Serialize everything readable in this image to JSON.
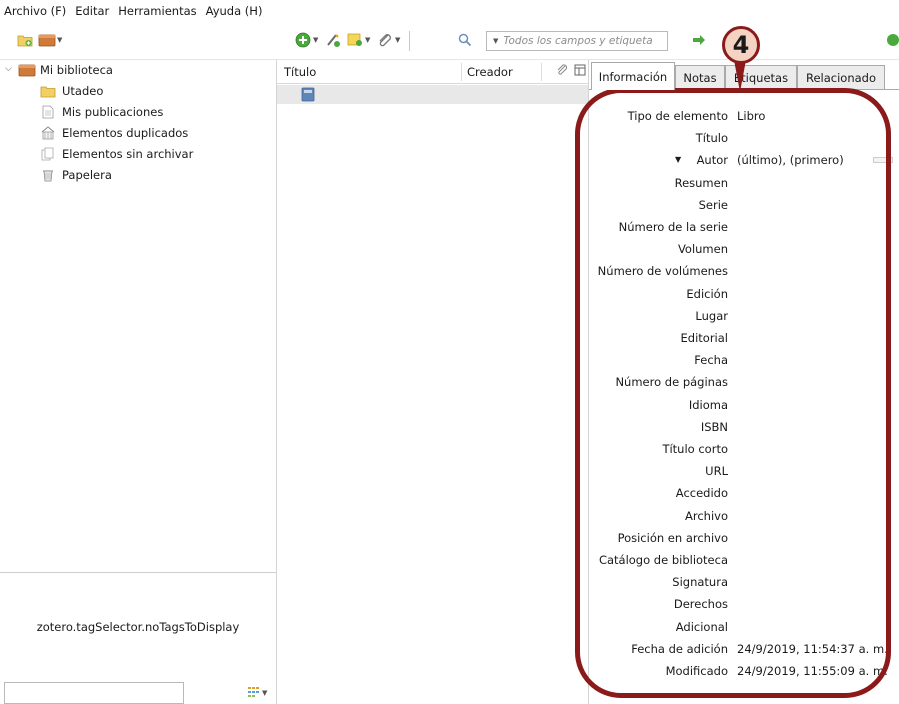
{
  "menubar": {
    "archivo": "Archivo (F)",
    "editar": "Editar",
    "herramientas": "Herramientas",
    "ayuda": "Ayuda (H)"
  },
  "toolbar": {
    "search_placeholder": "Todos los campos y etiqueta",
    "icons": [
      "new-collection-icon",
      "new-library-icon",
      "new-item-icon",
      "add-by-identifier-icon",
      "new-note-icon",
      "add-attachment-icon",
      "search-icon",
      "sync-icon"
    ]
  },
  "sidebar": {
    "library_label": "Mi biblioteca",
    "collections": [
      {
        "label": "Utadeo",
        "icon": "folder-icon"
      },
      {
        "label": "Mis publicaciones",
        "icon": "document-icon"
      },
      {
        "label": "Elementos duplicados",
        "icon": "duplicates-icon"
      },
      {
        "label": "Elementos sin archivar",
        "icon": "unfiled-icon"
      },
      {
        "label": "Papelera",
        "icon": "trash-icon"
      }
    ],
    "tag_selector_message": "zotero.tagSelector.noTagsToDisplay"
  },
  "items_list": {
    "columns": [
      "Título",
      "Creador"
    ]
  },
  "item_pane": {
    "tabs": [
      "Información",
      "Notas",
      "Etiquetas",
      "Relacionado"
    ],
    "active_tab": "Información",
    "fields": [
      {
        "label": "Tipo de elemento",
        "value": "Libro"
      },
      {
        "label": "Título",
        "value": ""
      },
      {
        "label": "Autor",
        "value": "(último), (primero)"
      },
      {
        "label": "Resumen",
        "value": ""
      },
      {
        "label": "Serie",
        "value": ""
      },
      {
        "label": "Número de la serie",
        "value": ""
      },
      {
        "label": "Volumen",
        "value": ""
      },
      {
        "label": "Número de volúmenes",
        "value": ""
      },
      {
        "label": "Edición",
        "value": ""
      },
      {
        "label": "Lugar",
        "value": ""
      },
      {
        "label": "Editorial",
        "value": ""
      },
      {
        "label": "Fecha",
        "value": ""
      },
      {
        "label": "Número de páginas",
        "value": ""
      },
      {
        "label": "Idioma",
        "value": ""
      },
      {
        "label": "ISBN",
        "value": ""
      },
      {
        "label": "Título corto",
        "value": ""
      },
      {
        "label": "URL",
        "value": ""
      },
      {
        "label": "Accedido",
        "value": ""
      },
      {
        "label": "Archivo",
        "value": ""
      },
      {
        "label": "Posición en archivo",
        "value": ""
      },
      {
        "label": "Catálogo de biblioteca",
        "value": ""
      },
      {
        "label": "Signatura",
        "value": ""
      },
      {
        "label": "Derechos",
        "value": ""
      },
      {
        "label": "Adicional",
        "value": ""
      },
      {
        "label": "Fecha de adición",
        "value": "24/9/2019, 11:54:37 a. m."
      },
      {
        "label": "Modificado",
        "value": "24/9/2019, 11:55:09 a. m."
      }
    ]
  },
  "annotation": {
    "badge_number": "4",
    "color": "#8b1a1a"
  }
}
